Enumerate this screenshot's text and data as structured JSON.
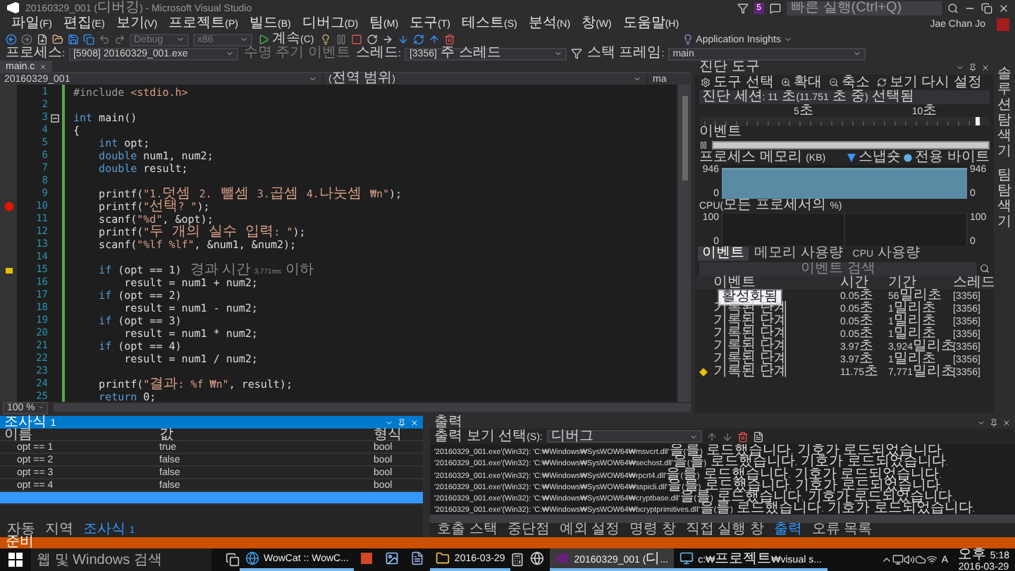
{
  "window": {
    "title": "20160329_001 (디버깅) - Microsoft Visual Studio",
    "notification_count": "5",
    "quick_launch": {
      "placeholder": "빠른 실행(Ctrl+Q)"
    },
    "user": "Jae Chan Jo"
  },
  "menu": [
    "파일(F)",
    "편집(E)",
    "보기(V)",
    "프로젝트(P)",
    "빌드(B)",
    "디버그(D)",
    "팀(M)",
    "도구(T)",
    "테스트(S)",
    "분석(N)",
    "창(W)",
    "도움말(H)"
  ],
  "toolbar": {
    "configuration": "Debug",
    "platform": "x86",
    "continue": "계속(C)",
    "insights": "Application Insights"
  },
  "debug_location": {
    "process_label": "프로세스:",
    "process": "[5908] 20160329_001.exe",
    "lifecycle": "수명 주기 이벤트",
    "thread_label": "스레드:",
    "thread": "[3356] 주 스레드",
    "frame_label": "스택 프레임:",
    "frame": "main"
  },
  "editor": {
    "tabs": [
      {
        "label": "main.c",
        "selected": true
      }
    ],
    "project": "20160329_001",
    "scope": "(전역 범위)",
    "member": "ma",
    "zoom": "100 %",
    "lines": [
      {
        "number": "1",
        "tokens": [
          {
            "kind": "preprocessor",
            "text": "#include "
          },
          {
            "kind": "include",
            "text": "<stdio.h>"
          }
        ]
      },
      {
        "number": "2"
      },
      {
        "number": "3",
        "collapsible": true,
        "tokens": [
          {
            "kind": "keyword",
            "text": "int"
          },
          {
            "kind": "plain",
            "text": " main()"
          }
        ]
      },
      {
        "number": "4",
        "tokens": [
          {
            "kind": "plain",
            "text": "{"
          }
        ]
      },
      {
        "number": "5",
        "tokens": [
          {
            "kind": "keyword",
            "text": "    int"
          },
          {
            "kind": "plain",
            "text": " opt;"
          }
        ]
      },
      {
        "number": "6",
        "tokens": [
          {
            "kind": "keyword",
            "text": "    double"
          },
          {
            "kind": "plain",
            "text": " num1, num2;"
          }
        ]
      },
      {
        "number": "7",
        "tokens": [
          {
            "kind": "keyword",
            "text": "    double"
          },
          {
            "kind": "plain",
            "text": " result;"
          }
        ]
      },
      {
        "number": "8"
      },
      {
        "number": "9",
        "tokens": [
          {
            "kind": "plain",
            "text": "    printf("
          },
          {
            "kind": "string",
            "text": "\"1.덧셈 2. 뺄셈 3.곱셈 4.나눗셈 ₩n\""
          },
          {
            "kind": "plain",
            "text": ");"
          }
        ]
      },
      {
        "number": "10",
        "breakpoint": true,
        "tokens": [
          {
            "kind": "plain",
            "text": "    printf("
          },
          {
            "kind": "string",
            "text": "\"선택? \""
          },
          {
            "kind": "plain",
            "text": ");"
          }
        ]
      },
      {
        "number": "11",
        "tokens": [
          {
            "kind": "plain",
            "text": "    scanf("
          },
          {
            "kind": "string",
            "text": "\"%d\""
          },
          {
            "kind": "plain",
            "text": ", &opt);"
          }
        ]
      },
      {
        "number": "12",
        "tokens": [
          {
            "kind": "plain",
            "text": "    printf("
          },
          {
            "kind": "string",
            "text": "\"두 개의 실수 입력: \""
          },
          {
            "kind": "plain",
            "text": ");"
          }
        ]
      },
      {
        "number": "13",
        "tokens": [
          {
            "kind": "plain",
            "text": "    scanf("
          },
          {
            "kind": "string",
            "text": "\"%lf %lf\""
          },
          {
            "kind": "plain",
            "text": ", &num1, &num2);"
          }
        ]
      },
      {
        "number": "14"
      },
      {
        "number": "15",
        "current": true,
        "hint": "경과 시간 3,771ms 이하",
        "tokens": [
          {
            "kind": "keyword",
            "text": "    if"
          },
          {
            "kind": "plain",
            "text": " (opt == 1)"
          }
        ]
      },
      {
        "number": "16",
        "tokens": [
          {
            "kind": "plain",
            "text": "        result = num1 + num2;"
          }
        ]
      },
      {
        "number": "17",
        "tokens": [
          {
            "kind": "keyword",
            "text": "    if"
          },
          {
            "kind": "plain",
            "text": " (opt == 2)"
          }
        ]
      },
      {
        "number": "18",
        "tokens": [
          {
            "kind": "plain",
            "text": "        result = num1 - num2;"
          }
        ]
      },
      {
        "number": "19",
        "tokens": [
          {
            "kind": "keyword",
            "text": "    if"
          },
          {
            "kind": "plain",
            "text": " (opt == 3)"
          }
        ]
      },
      {
        "number": "20",
        "tokens": [
          {
            "kind": "plain",
            "text": "        result = num1 * num2;"
          }
        ]
      },
      {
        "number": "21",
        "tokens": [
          {
            "kind": "keyword",
            "text": "    if"
          },
          {
            "kind": "plain",
            "text": " (opt == 4)"
          }
        ]
      },
      {
        "number": "22",
        "tokens": [
          {
            "kind": "plain",
            "text": "        result = num1 / num2;"
          }
        ]
      },
      {
        "number": "23"
      },
      {
        "number": "24",
        "tokens": [
          {
            "kind": "plain",
            "text": "    printf("
          },
          {
            "kind": "string",
            "text": "\"결과: %f ₩n\""
          },
          {
            "kind": "plain",
            "text": ", result);"
          }
        ]
      },
      {
        "number": "25",
        "tokens": [
          {
            "kind": "keyword",
            "text": "    return"
          },
          {
            "kind": "plain",
            "text": " 0;"
          }
        ]
      }
    ]
  },
  "diagnostics": {
    "title": "진단 도구",
    "toolbar": [
      "도구 선택",
      "확대",
      "축소",
      "보기 다시 설정"
    ],
    "session": "진단 세션: 11 초(11.751 초 중) 선택됨",
    "ruler": [
      "5초",
      "10초"
    ],
    "events_label": "이벤트",
    "memory": {
      "label": "프로세스 메모리 (KB)",
      "legend": [
        "스냅숏",
        "전용 바이트"
      ],
      "left_axis": [
        "946",
        "0"
      ],
      "right_axis": [
        "946",
        "0"
      ]
    },
    "cpu": {
      "label": "CPU(모든 프로세서의 %)",
      "left_axis": [
        "100",
        "0"
      ],
      "right_axis": [
        "100",
        "0"
      ]
    },
    "tabs": [
      {
        "label": "이벤트",
        "selected": true
      },
      {
        "label": "메모리 사용량",
        "selected": false
      },
      {
        "label": "CPU 사용량",
        "selected": false
      }
    ],
    "search": {
      "placeholder": "이벤트 검색"
    },
    "columns": [
      "이벤트",
      "시간",
      "기간",
      "스레드"
    ],
    "tooltip": "활성화됨",
    "rows": [
      {
        "time": "0.05초",
        "duration": "56밀리초",
        "thread": "[3356]",
        "current": false
      },
      {
        "event": "기록된 단계",
        "time": "0.05초",
        "duration": "1밀리초",
        "thread": "[3356]",
        "current": false
      },
      {
        "event": "기록된 단계",
        "time": "0.05초",
        "duration": "1밀리초",
        "thread": "[3356]",
        "current": false
      },
      {
        "event": "기록된 단계",
        "time": "0.05초",
        "duration": "1밀리초",
        "thread": "[3356]",
        "current": false
      },
      {
        "event": "기록된 단계",
        "time": "3.97초",
        "duration": "3,924밀리초",
        "thread": "[3356]",
        "current": false
      },
      {
        "event": "기록된 단계",
        "time": "3.97초",
        "duration": "1밀리초",
        "thread": "[3356]",
        "current": false
      },
      {
        "event": "기록된 단계",
        "time": "11.75초",
        "duration": "7,771밀리초",
        "thread": "[3356]",
        "current": true
      }
    ]
  },
  "side_tabs": [
    "솔루션 탐색기",
    "팀 탐색기"
  ],
  "watch": {
    "title": "조사식 1",
    "columns": [
      "이름",
      "값",
      "형식"
    ],
    "rows": [
      {
        "name": "opt == 1",
        "value": "true",
        "type": "bool"
      },
      {
        "name": "opt == 2",
        "value": "false",
        "type": "bool"
      },
      {
        "name": "opt == 3",
        "value": "false",
        "type": "bool"
      },
      {
        "name": "opt == 4",
        "value": "false",
        "type": "bool"
      }
    ],
    "entry_row": {
      "selected": true
    },
    "tabs": [
      {
        "label": "자동",
        "selected": false
      },
      {
        "label": "지역",
        "selected": false
      },
      {
        "label": "조사식 1",
        "selected": true
      }
    ]
  },
  "output": {
    "title": "출력",
    "source_label": "출력 보기 선택(S):",
    "source": "디버그",
    "lines": [
      "'20160329_001.exe'(Win32): 'C:₩Windows₩SysWOW64₩msvcrt.dll'을(를) 로드했습니다. 기호가 로드되었습니다.",
      "'20160329_001.exe'(Win32): 'C:₩Windows₩SysWOW64₩sechost.dll'을(를) 로드했습니다. 기호가 로드되었습니다.",
      "'20160329_001.exe'(Win32): 'C:₩Windows₩SysWOW64₩rpcrt4.dll'을(를) 로드했습니다. 기호가 로드되었습니다.",
      "'20160329_001.exe'(Win32): 'C:₩Windows₩SysWOW64₩sspicli.dll'을(를) 로드했습니다. 기호가 로드되었습니다.",
      "'20160329_001.exe'(Win32): 'C:₩Windows₩SysWOW64₩cryptbase.dll'을(를) 로드했습니다. 기호가 로드되었습니다.",
      "'20160329_001.exe'(Win32): 'C:₩Windows₩SysWOW64₩bcryptprimitives.dll'을(를) 로드했습니다. 기호가 로드되었습니다."
    ],
    "tabs": [
      {
        "label": "호출 스택",
        "selected": false
      },
      {
        "label": "중단점",
        "selected": false
      },
      {
        "label": "예외 설정",
        "selected": false
      },
      {
        "label": "명령 창",
        "selected": false
      },
      {
        "label": "직접 실행 창",
        "selected": false
      },
      {
        "label": "출력",
        "selected": true
      },
      {
        "label": "오류 목록",
        "selected": false
      }
    ]
  },
  "status_bar": {
    "text": "준비"
  },
  "taskbar": {
    "search": {
      "placeholder": "웹 및 Windows 검색"
    },
    "apps": [
      {
        "kind": "browser",
        "label": "WowCat :: WowC...",
        "open": true,
        "selected": false
      },
      {
        "kind": "slides",
        "open": false,
        "selected": false
      },
      {
        "kind": "paint",
        "open": false,
        "selected": false
      },
      {
        "kind": "notepad",
        "open": false,
        "selected": false
      },
      {
        "kind": "folder",
        "label": "2016-03-29",
        "open": true,
        "selected": false
      }
    ],
    "apps_right": [
      {
        "kind": "globe",
        "open": false,
        "selected": false
      },
      {
        "kind": "studio",
        "label": "20160329_001 (디...",
        "open": true,
        "selected": true
      },
      {
        "kind": "console",
        "label": "c:₩프로젝트₩visual s...",
        "open": true,
        "selected": false
      }
    ],
    "input_mode": "A",
    "time": "오후 5:18",
    "date": "2016-03-29"
  }
}
